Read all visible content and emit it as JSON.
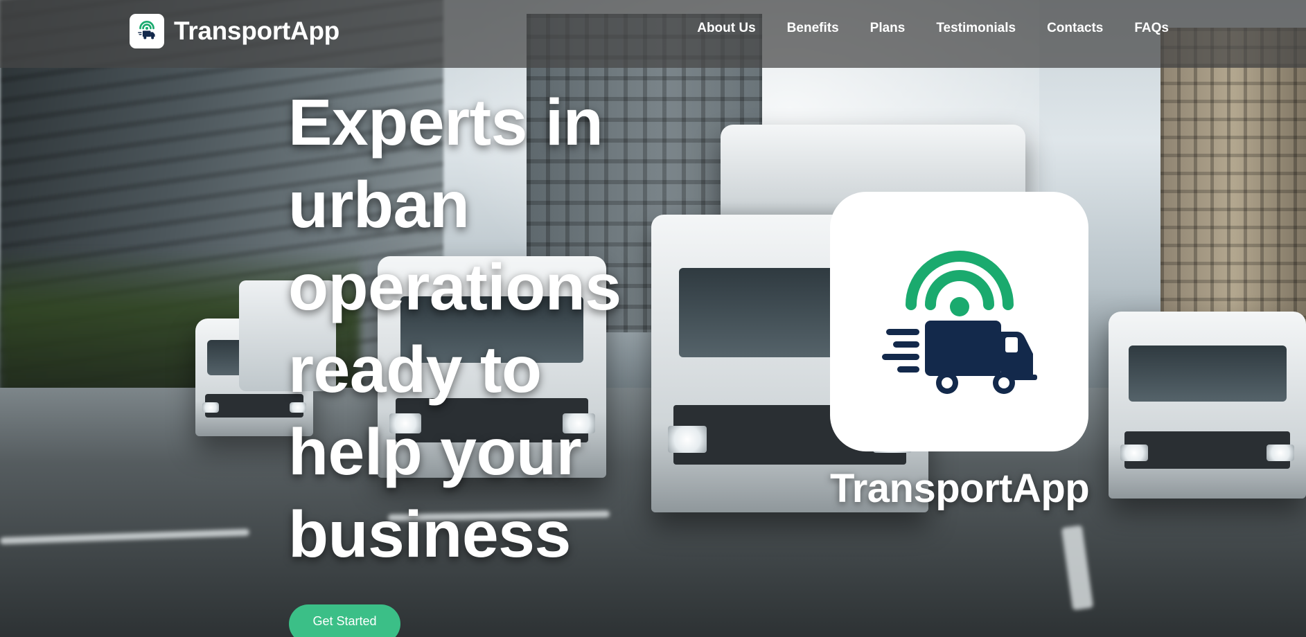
{
  "header": {
    "brand_name": "TransportApp",
    "brand_icon": "truck-signal-icon",
    "nav": [
      {
        "label": "About Us"
      },
      {
        "label": "Benefits"
      },
      {
        "label": "Plans"
      },
      {
        "label": "Testimonials"
      },
      {
        "label": "Contacts"
      },
      {
        "label": "FAQs"
      }
    ]
  },
  "hero": {
    "headline": "Experts in urban operations ready to help your business",
    "cta_label": "Get Started",
    "card_title": "TransportApp",
    "card_icon": "truck-signal-icon"
  },
  "colors": {
    "accent_green": "#3bbf87",
    "signal_green": "#1aaa6e",
    "truck_navy": "#13294b",
    "header_overlay": "rgba(70,70,70,0.72)"
  }
}
